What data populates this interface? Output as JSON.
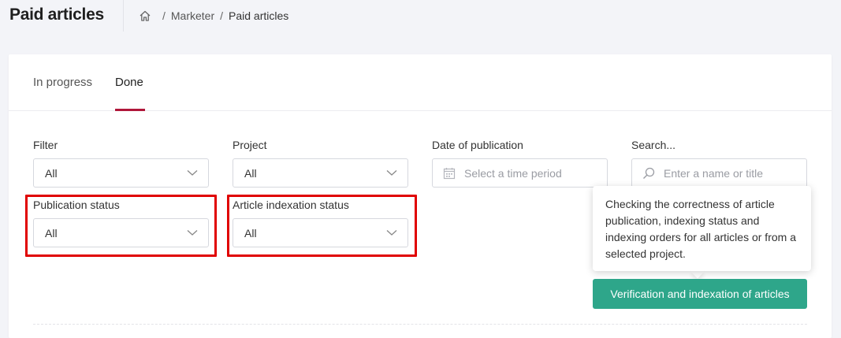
{
  "header": {
    "title": "Paid articles",
    "breadcrumb": [
      "Marketer",
      "Paid articles"
    ],
    "separator": "/"
  },
  "tabs": [
    {
      "label": "In progress",
      "active": false
    },
    {
      "label": "Done",
      "active": true
    }
  ],
  "filters": {
    "filter": {
      "label": "Filter",
      "value": "All"
    },
    "project": {
      "label": "Project",
      "value": "All"
    },
    "date": {
      "label": "Date of publication",
      "placeholder": "Select a time period"
    },
    "search": {
      "label": "Search...",
      "placeholder": "Enter a name or title"
    },
    "publication_status": {
      "label": "Publication status",
      "value": "All"
    },
    "indexation_status": {
      "label": "Article indexation status",
      "value": "All"
    }
  },
  "tooltip": {
    "text": "Checking the correctness of article publication, indexing status and indexing orders for all articles or from a selected project."
  },
  "action_button": {
    "label": "Verification and indexation of articles"
  },
  "colors": {
    "accent": "#b0173a",
    "primary_button": "#2ea68a",
    "highlight": "#e00000",
    "background": "#f3f4f8"
  },
  "icons": [
    "home-icon",
    "chevron-down-icon",
    "calendar-icon",
    "search-icon"
  ]
}
